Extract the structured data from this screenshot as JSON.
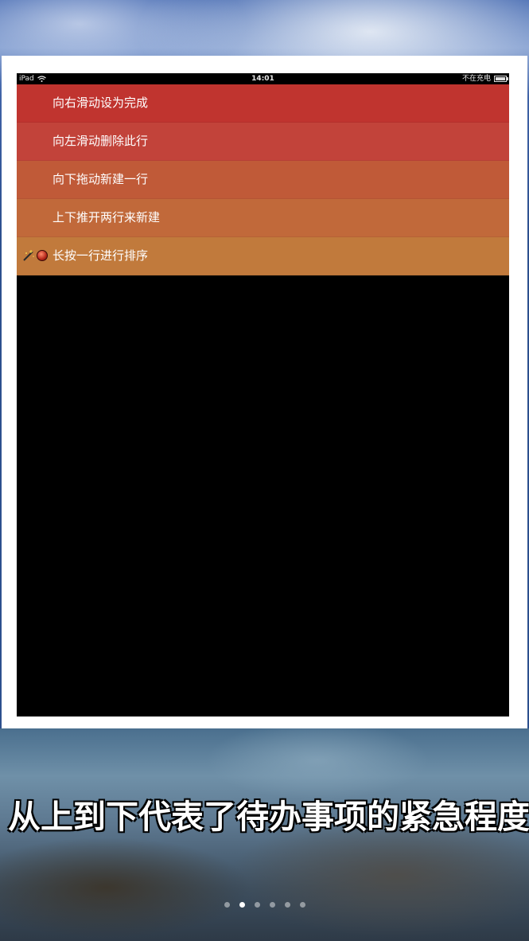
{
  "statusbar": {
    "device": "iPad",
    "time": "14:01",
    "charging": "不在充电"
  },
  "rows": [
    {
      "label": "向右滑动设为完成",
      "color": "#c0342f"
    },
    {
      "label": "向左滑动删除此行",
      "color": "#c2433a"
    },
    {
      "label": "向下拖动新建一行",
      "color": "#c05a38"
    },
    {
      "label": "上下推开两行来新建",
      "color": "#c1693a"
    },
    {
      "label": "长按一行进行排序",
      "color": "#c17a3c",
      "icons": [
        "wand-icon",
        "ball-icon"
      ]
    }
  ],
  "caption": "从上到下代表了待办事项的紧急程度",
  "pager": {
    "count": 6,
    "active": 1
  }
}
